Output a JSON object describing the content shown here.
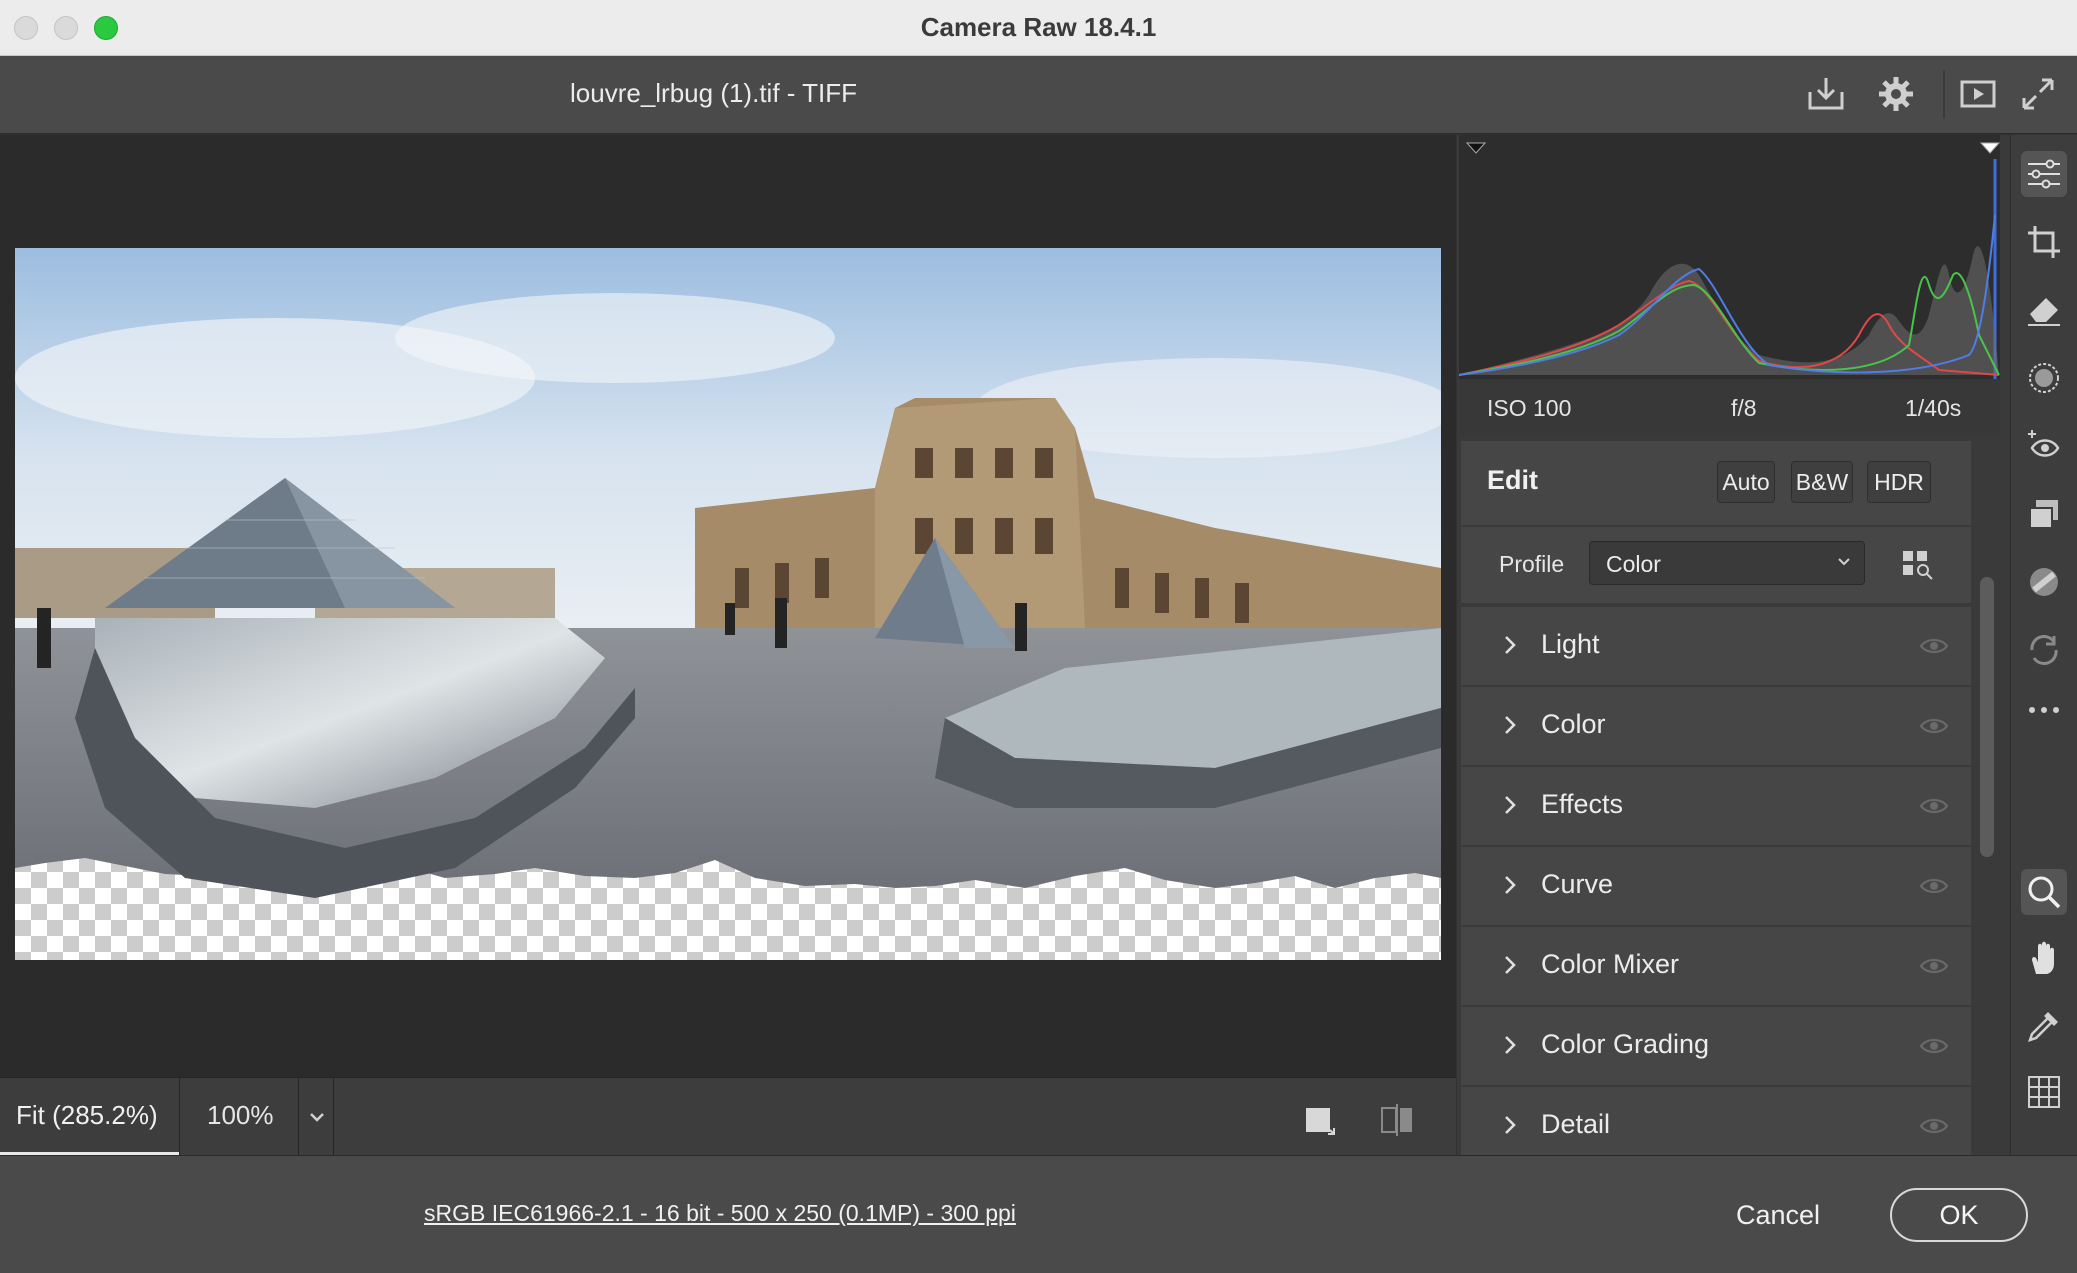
{
  "window": {
    "title": "Camera Raw 18.4.1"
  },
  "header": {
    "file_title": "louvre_lrbug (1).tif  -  TIFF",
    "icons": [
      "save-download-icon",
      "settings-gear-icon",
      "fullscreen-preview-icon",
      "expand-icon"
    ]
  },
  "preview": {
    "image_subject": "Louvre panorama",
    "zoom_fit_label": "Fit (285.2%)",
    "zoom_100_label": "100%"
  },
  "exif": {
    "iso": "ISO 100",
    "aperture": "f/8",
    "shutter": "1/40s"
  },
  "edit": {
    "title": "Edit",
    "buttons": {
      "auto": "Auto",
      "bw": "B&W",
      "hdr": "HDR"
    },
    "profile_label": "Profile",
    "profile_value": "Color"
  },
  "sections": [
    {
      "label": "Light"
    },
    {
      "label": "Color"
    },
    {
      "label": "Effects"
    },
    {
      "label": "Curve"
    },
    {
      "label": "Color Mixer"
    },
    {
      "label": "Color Grading"
    },
    {
      "label": "Detail"
    }
  ],
  "tools": [
    "edit-sliders-icon",
    "crop-icon",
    "eraser-heal-icon",
    "masking-icon",
    "red-eye-icon",
    "presets-icon",
    "snapshots-icon",
    "sync-icon",
    "more-icon",
    "zoom-icon",
    "hand-icon",
    "color-sampler-icon",
    "grid-icon"
  ],
  "footer": {
    "info_link": "sRGB IEC61966-2.1 - 16 bit - 500 x 250 (0.1MP) - 300 ppi",
    "cancel_label": "Cancel",
    "ok_label": "OK"
  },
  "colors": {
    "accent_green": "#2ac940",
    "panel_bg": "#3a3a3a",
    "section_bg": "#464646"
  }
}
